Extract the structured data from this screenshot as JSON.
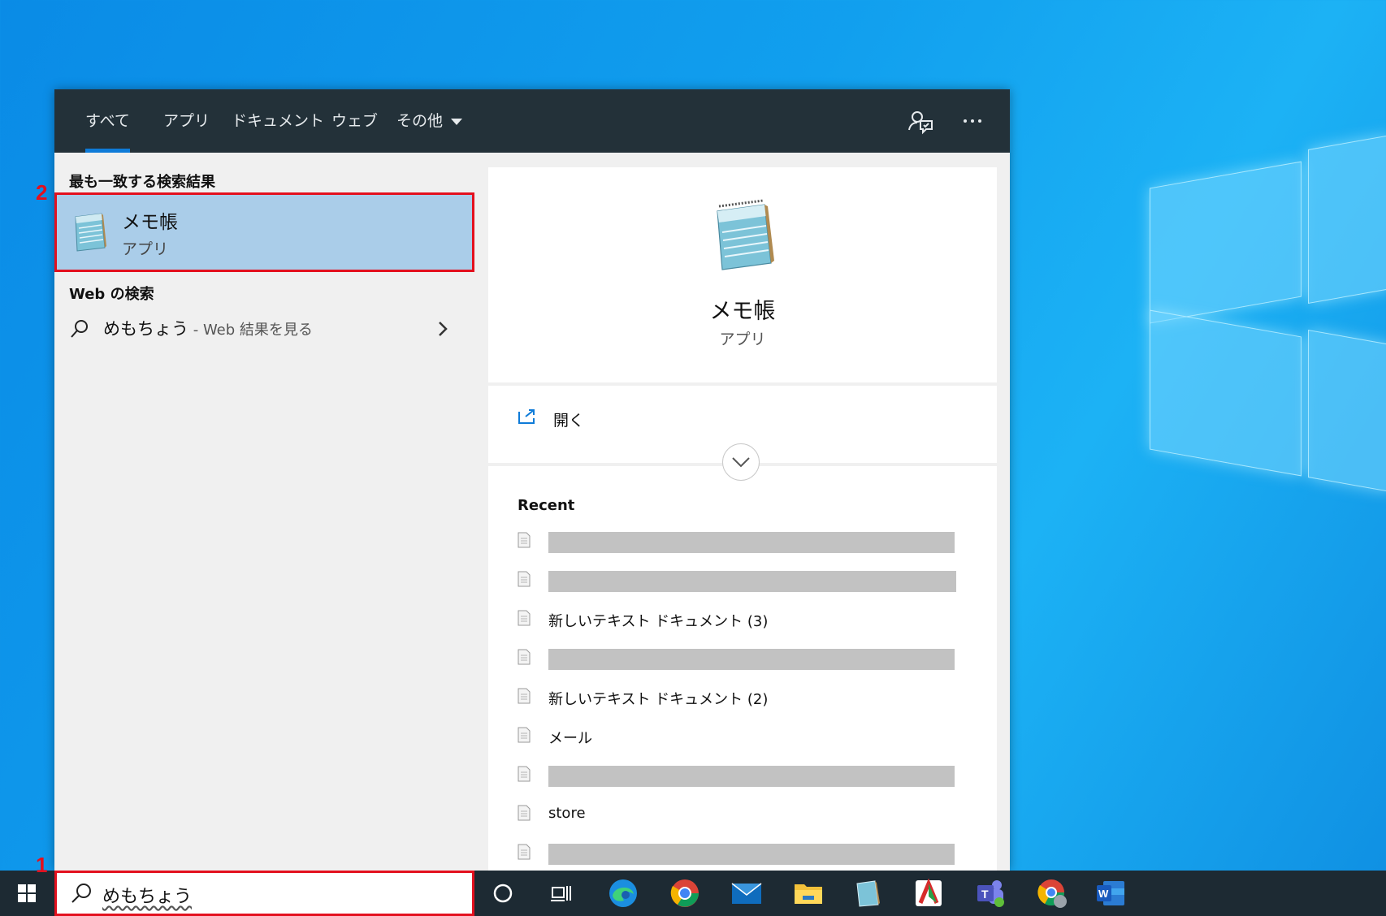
{
  "tabs": [
    {
      "label": "すべて"
    },
    {
      "label": "アプリ"
    },
    {
      "label": "ドキュメント"
    },
    {
      "label": "ウェブ"
    },
    {
      "label": "その他"
    }
  ],
  "top_icons": [
    "feedback-icon",
    "more-options-icon"
  ],
  "left": {
    "best_match_title": "最も一致する検索結果",
    "best_match": {
      "name": "メモ帳",
      "type": "アプリ"
    },
    "web_title": "Web の検索",
    "web_query": "めもちょう",
    "web_suffix": " - Web 結果を見る"
  },
  "preview": {
    "app_name": "メモ帳",
    "app_type": "アプリ",
    "open_label": "開く",
    "recent_title": "Recent",
    "recent_items": [
      {
        "text": ""
      },
      {
        "text": ""
      },
      {
        "text": "新しいテキスト ドキュメント (3)"
      },
      {
        "text": ""
      },
      {
        "text": "新しいテキスト ドキュメント (2)"
      },
      {
        "text": "メール"
      },
      {
        "text": ""
      },
      {
        "text": "store"
      },
      {
        "text": ""
      }
    ]
  },
  "search": {
    "query": "めもちょう"
  },
  "markers": {
    "one": "1",
    "two": "2"
  },
  "taskbar_icons": [
    "windows-start-icon",
    "cortana-icon",
    "task-view-icon",
    "edge-icon",
    "chrome-icon",
    "mail-icon",
    "file-explorer-icon",
    "notepad-icon",
    "snipping-app-icon",
    "teams-icon",
    "chrome-profile-icon",
    "word-icon"
  ],
  "colors": {
    "topbar": "#233139",
    "accent": "#0e7bd8",
    "selected": "#aacde9",
    "highlight": "#e3101e"
  }
}
